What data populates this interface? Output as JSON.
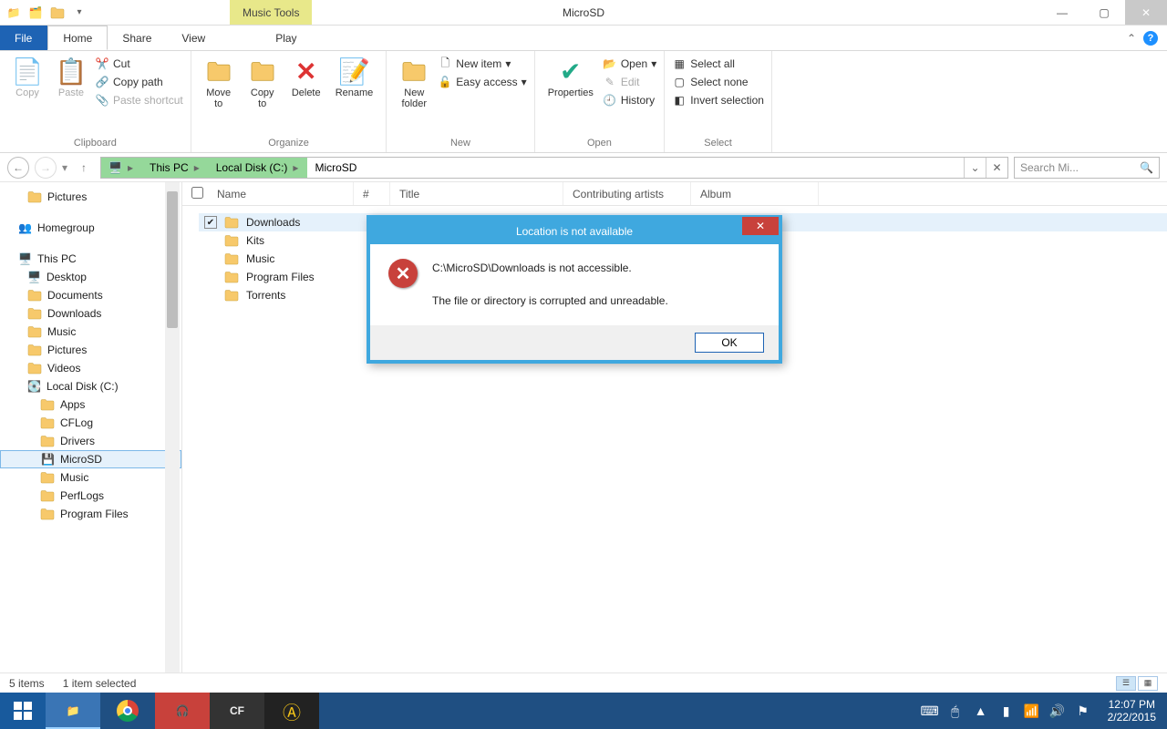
{
  "titlebar": {
    "title": "MicroSD",
    "music_tools": "Music Tools"
  },
  "tabs": {
    "file": "File",
    "home": "Home",
    "share": "Share",
    "view": "View",
    "play": "Play"
  },
  "ribbon": {
    "clipboard": {
      "copy": "Copy",
      "paste": "Paste",
      "cut": "Cut",
      "copy_path": "Copy path",
      "paste_shortcut": "Paste shortcut",
      "label": "Clipboard"
    },
    "organize": {
      "move_to": "Move\nto",
      "copy_to": "Copy\nto",
      "delete": "Delete",
      "rename": "Rename",
      "label": "Organize"
    },
    "new": {
      "new_folder": "New\nfolder",
      "new_item": "New item",
      "easy_access": "Easy access",
      "label": "New"
    },
    "open": {
      "properties": "Properties",
      "open": "Open",
      "edit": "Edit",
      "history": "History",
      "label": "Open"
    },
    "select": {
      "select_all": "Select all",
      "select_none": "Select none",
      "invert": "Invert selection",
      "label": "Select"
    }
  },
  "breadcrumb": {
    "this_pc": "This PC",
    "local_disk": "Local Disk (C:)",
    "microsd": "MicroSD"
  },
  "search": {
    "placeholder": "Search Mi..."
  },
  "columns": {
    "name": "Name",
    "num": "#",
    "title": "Title",
    "artists": "Contributing artists",
    "album": "Album"
  },
  "navpane": {
    "pictures": "Pictures",
    "homegroup": "Homegroup",
    "this_pc": "This PC",
    "desktop": "Desktop",
    "documents": "Documents",
    "downloads": "Downloads",
    "music": "Music",
    "pictures2": "Pictures",
    "videos": "Videos",
    "local_disk": "Local Disk (C:)",
    "apps": "Apps",
    "cflog": "CFLog",
    "drivers": "Drivers",
    "microsd": "MicroSD",
    "music2": "Music",
    "perflogs": "PerfLogs",
    "program_files": "Program Files"
  },
  "files": {
    "downloads": "Downloads",
    "kits": "Kits",
    "music": "Music",
    "program_files": "Program Files",
    "torrents": "Torrents"
  },
  "dialog": {
    "title": "Location is not available",
    "line1": "C:\\MicroSD\\Downloads is not accessible.",
    "line2": "The file or directory is corrupted and unreadable.",
    "ok": "OK"
  },
  "status": {
    "items": "5 items",
    "selected": "1 item selected"
  },
  "clock": {
    "time": "12:07 PM",
    "date": "2/22/2015"
  }
}
